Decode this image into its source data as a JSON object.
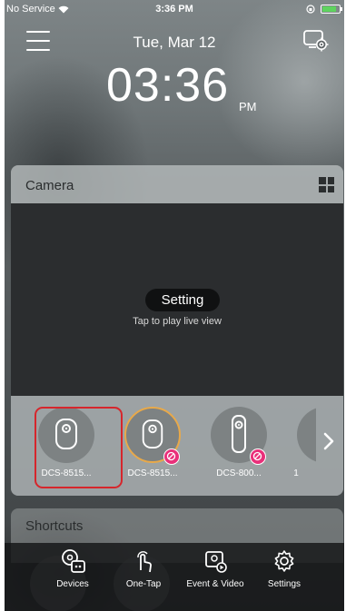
{
  "status_bar": {
    "carrier": "No Service",
    "time": "3:36 PM",
    "battery_level": 0.85
  },
  "header": {
    "date": "Tue, Mar 12",
    "clock": "03:36",
    "ampm": "PM"
  },
  "camera": {
    "title": "Camera",
    "setting_label": "Setting",
    "tap_hint": "Tap to play live view",
    "devices": [
      {
        "label": "DCS-8515...",
        "state": "selected"
      },
      {
        "label": "DCS-8515...",
        "state": "offline"
      },
      {
        "label": "DCS-800...",
        "state": "offline"
      },
      {
        "label": "1"
      }
    ]
  },
  "shortcuts": {
    "title": "Shortcuts"
  },
  "tabs": [
    {
      "label": "Devices"
    },
    {
      "label": "One-Tap"
    },
    {
      "label": "Event & Video"
    },
    {
      "label": "Settings"
    }
  ],
  "colors": {
    "accent_ring": "#e8a94a",
    "offline_badge": "#e9307a",
    "highlight": "#d6262c"
  }
}
